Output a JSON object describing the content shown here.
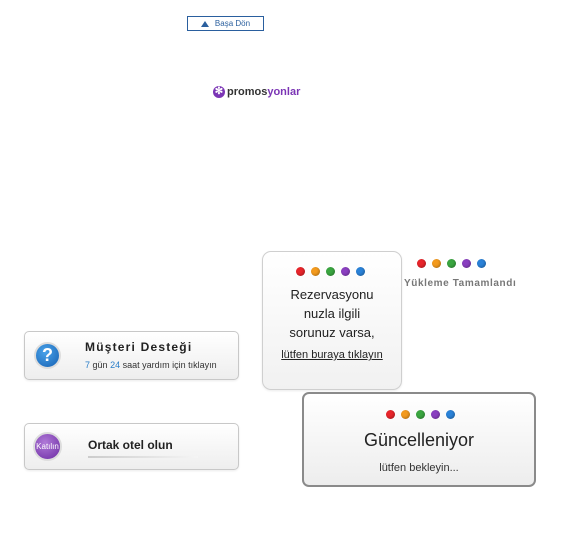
{
  "back_to_top": {
    "label": "Başa Dön"
  },
  "promos": {
    "part1": "promos",
    "part2": "yonlar",
    "icon": "star-icon",
    "brand_color": "#7b35b5"
  },
  "dot_colors": [
    "#e8252b",
    "#f39a1d",
    "#3aa640",
    "#8a3fc0",
    "#2a82d8"
  ],
  "reservation": {
    "text_lines": [
      "Rezervasyonu",
      "nuzla ilgili",
      "sorunuz varsa,"
    ],
    "link": "lütfen buraya tıklayın"
  },
  "loading": {
    "label": "Yükleme Tamamlandı"
  },
  "support": {
    "title": "Müşteri Desteği",
    "icon": "question-icon",
    "sub_days": "7",
    "sub_gun": "gün",
    "sub_hours": "24",
    "sub_rest": "saat yardım için tıklayın"
  },
  "partner": {
    "badge": "Katılın",
    "title": "Ortak otel olun"
  },
  "update": {
    "title": "Güncelleniyor",
    "sub": "lütfen bekleyin..."
  }
}
